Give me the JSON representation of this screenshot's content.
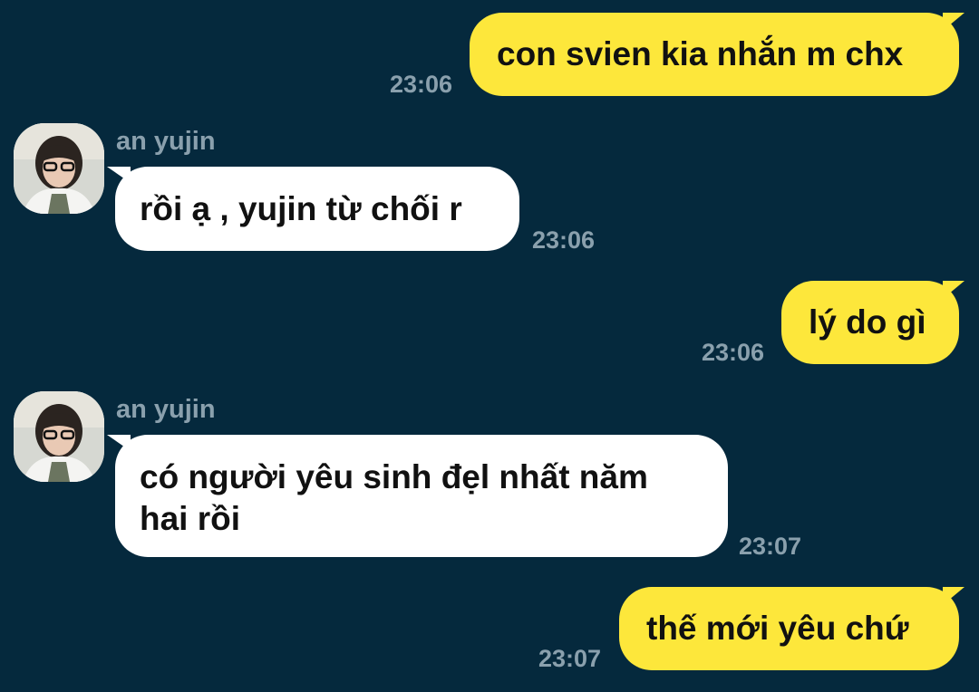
{
  "chat": {
    "messages": [
      {
        "direction": "out",
        "text": "con svien kia nhắn m chx",
        "time": "23:06"
      },
      {
        "direction": "in",
        "sender": "an yujin",
        "text": "rồi ạ , yujin từ chối r",
        "time": "23:06"
      },
      {
        "direction": "out",
        "text": "lý do gì",
        "time": "23:06"
      },
      {
        "direction": "in",
        "sender": "an yujin",
        "text_line1": "có người yêu sinh đẹl nhất năm",
        "text_line2": "hai rồi",
        "time": "23:07"
      },
      {
        "direction": "out",
        "text": "thế mới yêu chứ",
        "time": "23:07"
      }
    ]
  },
  "colors": {
    "background": "#05293d",
    "outgoing_bubble": "#fde73b",
    "incoming_bubble": "#ffffff",
    "meta_text": "#8aa0ad"
  },
  "icons": {
    "avatar": "profile-photo-avatar"
  }
}
